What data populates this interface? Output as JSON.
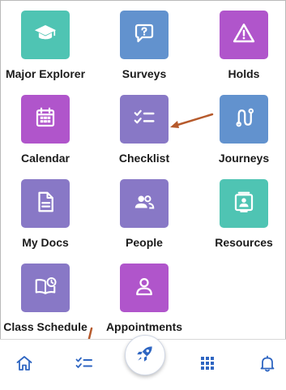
{
  "colors": {
    "teal": "#4fc4b3",
    "blue": "#6292ce",
    "magenta": "#b055cb",
    "purple": "#8878c6",
    "nav_icon": "#2f66c2",
    "annotation_arrow": "#b65a2c"
  },
  "tiles": [
    {
      "label": "Major Explorer",
      "icon": "graduation-cap-icon",
      "color": "teal"
    },
    {
      "label": "Surveys",
      "icon": "speech-bubble-question-icon",
      "color": "blue"
    },
    {
      "label": "Holds",
      "icon": "warning-triangle-icon",
      "color": "magenta"
    },
    {
      "label": "Calendar",
      "icon": "calendar-icon",
      "color": "magenta"
    },
    {
      "label": "Checklist",
      "icon": "checklist-icon",
      "color": "purple"
    },
    {
      "label": "Journeys",
      "icon": "journey-path-icon",
      "color": "blue"
    },
    {
      "label": "My Docs",
      "icon": "document-icon",
      "color": "purple"
    },
    {
      "label": "People",
      "icon": "people-icon",
      "color": "purple"
    },
    {
      "label": "Resources",
      "icon": "resources-icon",
      "color": "teal"
    },
    {
      "label": "Class Schedule",
      "icon": "book-clock-icon",
      "color": "purple"
    },
    {
      "label": "Appointments",
      "icon": "person-icon",
      "color": "magenta"
    }
  ],
  "nav": [
    {
      "name": "home",
      "icon": "home-icon"
    },
    {
      "name": "checklist",
      "icon": "checklist-icon"
    },
    {
      "name": "launch",
      "icon": "rocket-icon"
    },
    {
      "name": "apps",
      "icon": "grid-icon"
    },
    {
      "name": "notifications",
      "icon": "bell-icon"
    }
  ]
}
